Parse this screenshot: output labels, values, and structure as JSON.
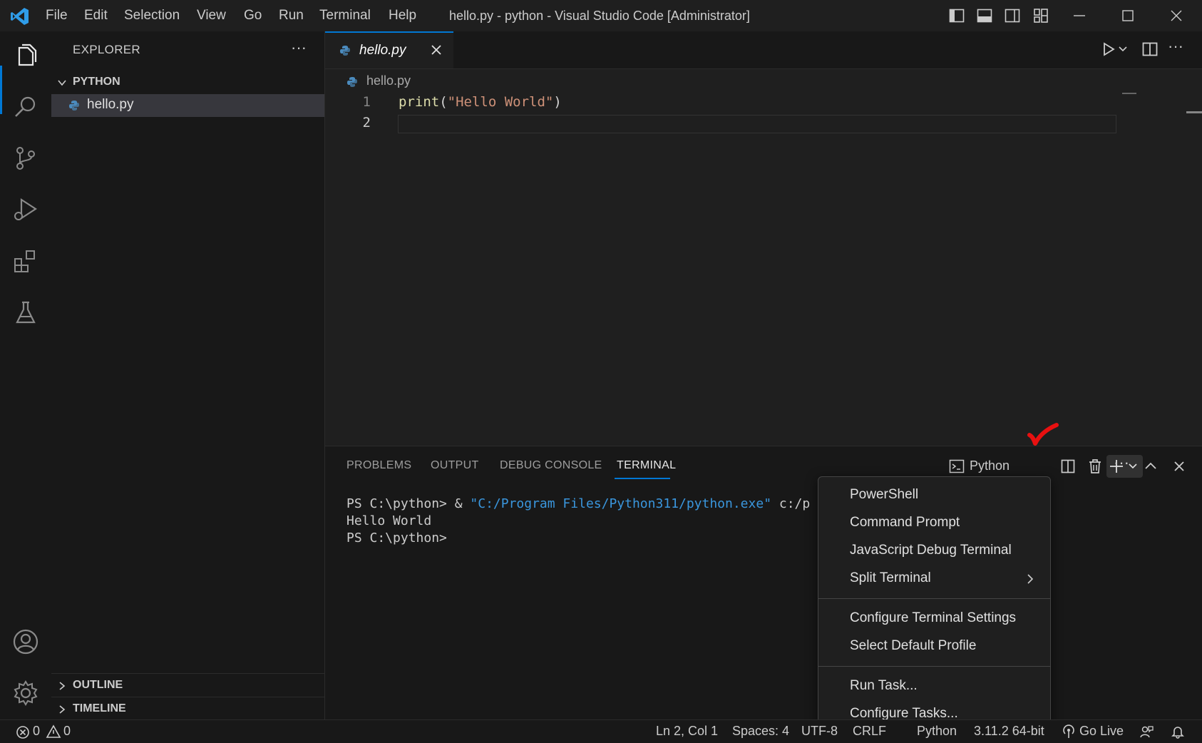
{
  "menubar": {
    "items": [
      "File",
      "Edit",
      "Selection",
      "View",
      "Go",
      "Run",
      "Terminal",
      "Help"
    ],
    "window_title": "hello.py - python - Visual Studio Code [Administrator]"
  },
  "sidebar": {
    "title": "EXPLORER",
    "folder": "PYTHON",
    "file": "hello.py",
    "outline": "OUTLINE",
    "timeline": "TIMELINE"
  },
  "editor": {
    "tab_label": "hello.py",
    "breadcrumb": "hello.py",
    "lines": [
      {
        "num": "1",
        "fn": "print",
        "open": "(",
        "str": "\"Hello World\"",
        "close": ")"
      },
      {
        "num": "2"
      }
    ]
  },
  "panel": {
    "tabs": [
      "PROBLEMS",
      "OUTPUT",
      "DEBUG CONSOLE",
      "TERMINAL"
    ],
    "active_tab": "TERMINAL",
    "terminal_profile": "Python",
    "terminal_lines": {
      "l1_prompt": "PS C:\\python> & ",
      "l1_str": "\"C:/Program Files/Python311/python.exe\"",
      "l1_rest": " c:/p",
      "l2": "Hello World",
      "l3": "PS C:\\python>"
    }
  },
  "terminal_menu": {
    "items": [
      "PowerShell",
      "Command Prompt",
      "JavaScript Debug Terminal",
      "Split Terminal",
      "Configure Terminal Settings",
      "Select Default Profile",
      "Run Task...",
      "Configure Tasks..."
    ]
  },
  "statusbar": {
    "errors": "0",
    "warnings": "0",
    "position": "Ln 2, Col 1",
    "spaces": "Spaces: 4",
    "encoding_partial": "UTF-8",
    "eol_partial": "CRLF",
    "language_partial": "Python",
    "interpreter_partial": "3.11.2 64-bit",
    "go_live": "Go Live"
  },
  "colors": {
    "accent": "#0078d4",
    "annotation": "#e81010"
  }
}
